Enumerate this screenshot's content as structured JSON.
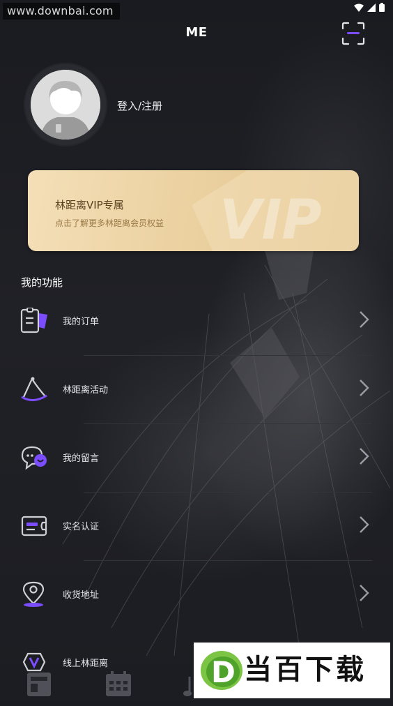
{
  "status_bar": {
    "watermark_text": "www.downbai.com",
    "icons": [
      "wifi-icon",
      "signal-icon",
      "battery-icon"
    ]
  },
  "header": {
    "title": "ME",
    "scan_icon": "scan-icon"
  },
  "profile": {
    "login_label": "登入/注册"
  },
  "vip_card": {
    "title": "林距离VIP专属",
    "subtitle": "点击了解更多林距离会员权益",
    "emblem_text": "VIP"
  },
  "functions": {
    "section_title": "我的功能",
    "items": [
      {
        "label": "我的订单",
        "icon": "order-icon"
      },
      {
        "label": "林距离活动",
        "icon": "hat-icon"
      },
      {
        "label": "我的留言",
        "icon": "message-icon"
      },
      {
        "label": "实名认证",
        "icon": "id-card-icon"
      },
      {
        "label": "收货地址",
        "icon": "location-icon"
      },
      {
        "label": "线上林距离",
        "icon": "v-badge-icon"
      }
    ]
  },
  "bottom_nav": {
    "icons": [
      "news-icon",
      "calendar-icon",
      "music-icon"
    ]
  },
  "brand_watermark": {
    "letter": "D",
    "text": "当百下载"
  },
  "colors": {
    "accent_purple": "#7b4dff",
    "vip_gold": "#ecd2a2",
    "background": "#1b1c21"
  }
}
